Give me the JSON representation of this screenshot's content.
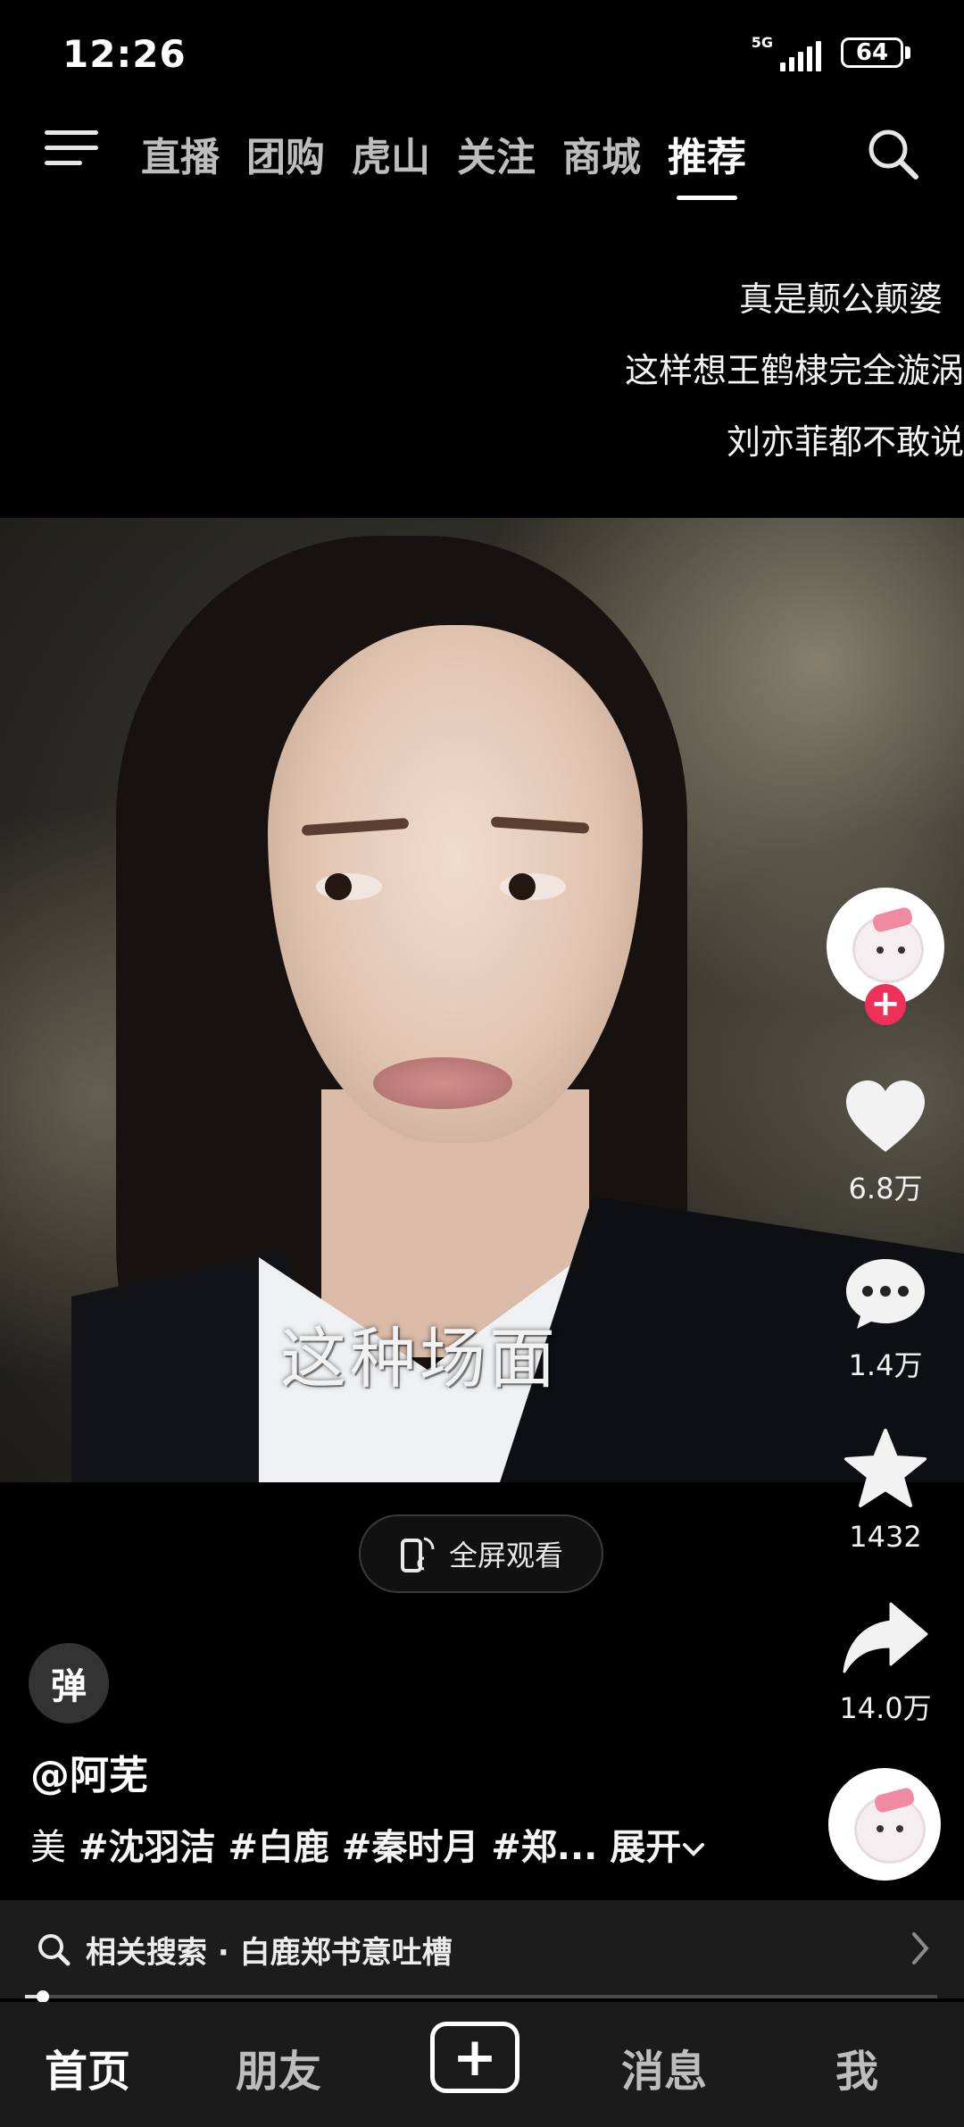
{
  "status_bar": {
    "time": "12:26",
    "network": "5G",
    "battery": "64"
  },
  "top_nav": {
    "tabs": [
      {
        "label": "直播"
      },
      {
        "label": "团购"
      },
      {
        "label": "虎山"
      },
      {
        "label": "关注"
      },
      {
        "label": "商城"
      },
      {
        "label": "推荐",
        "active": true
      }
    ]
  },
  "danmaku": [
    "真是颠公颠婆",
    "这样想王鹤棣完全漩涡",
    "刘亦菲都不敢说"
  ],
  "video": {
    "subtitle": "这种场面"
  },
  "fullscreen_button": {
    "label": "全屏观看"
  },
  "right_rail": {
    "likes": "6.8万",
    "comments": "1.4万",
    "favorites": "1432",
    "shares": "14.0万"
  },
  "caption": {
    "danmu_toggle": "弹",
    "author": "@阿芜",
    "text_prefix": "美",
    "hashtags": "#沈羽洁 #白鹿 #秦时月 #郑...",
    "expand": "展开"
  },
  "related_search": {
    "label": "相关搜索 · 白鹿郑书意吐槽"
  },
  "playback": {
    "progress_fraction": 0.02
  },
  "bottom_nav": {
    "home": "首页",
    "friends": "朋友",
    "messages": "消息",
    "me": "我"
  },
  "colors": {
    "follow_badge": "#ee3158",
    "background": "#000000",
    "bar": "#1b1b1b"
  }
}
